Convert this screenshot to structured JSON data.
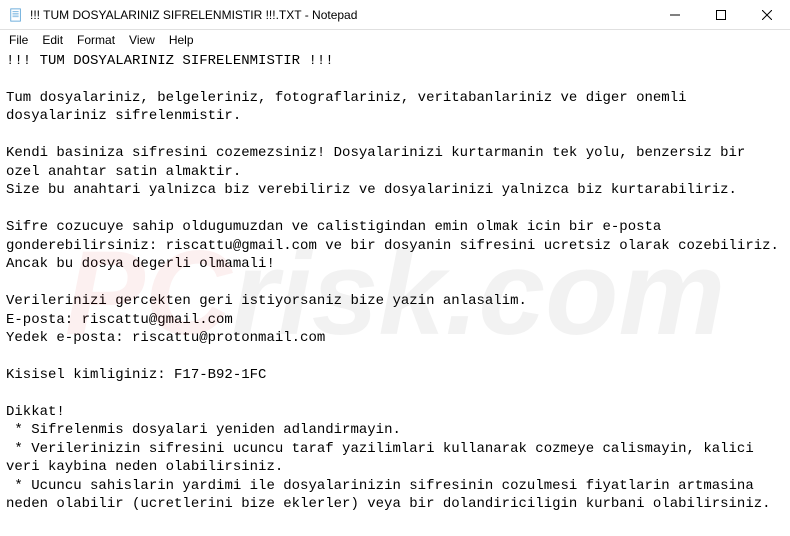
{
  "titlebar": {
    "text": "!!! TUM DOSYALARINIZ SIFRELENMISTIR !!!.TXT - Notepad"
  },
  "menubar": {
    "file": "File",
    "edit": "Edit",
    "format": "Format",
    "view": "View",
    "help": "Help"
  },
  "watermark": {
    "pc": "PC",
    "rest": "risk.com"
  },
  "content": {
    "text": "!!! TUM DOSYALARINIZ SIFRELENMISTIR !!!\n\nTum dosyalariniz, belgeleriniz, fotograflariniz, veritabanlariniz ve diger onemli dosyalariniz sifrelenmistir.\n\nKendi basiniza sifresini cozemezsiniz! Dosyalarinizi kurtarmanin tek yolu, benzersiz bir ozel anahtar satin almaktir.\nSize bu anahtari yalnizca biz verebiliriz ve dosyalarinizi yalnizca biz kurtarabiliriz.\n\nSifre cozucuye sahip oldugumuzdan ve calistigindan emin olmak icin bir e-posta gonderebilirsiniz: riscattu@gmail.com ve bir dosyanin sifresini ucretsiz olarak cozebiliriz.\nAncak bu dosya degerli olmamali!\n\nVerilerinizi gercekten geri istiyorsaniz bize yazin anlasalim.\nE-posta: riscattu@gmail.com\nYedek e-posta: riscattu@protonmail.com\n\nKisisel kimliginiz: F17-B92-1FC\n\nDikkat!\n * Sifrelenmis dosyalari yeniden adlandirmayin.\n * Verilerinizin sifresini ucuncu taraf yazilimlari kullanarak cozmeye calismayin, kalici veri kaybina neden olabilirsiniz.\n * Ucuncu sahislarin yardimi ile dosyalarinizin sifresinin cozulmesi fiyatlarin artmasina neden olabilir (ucretlerini bize eklerler) veya bir dolandiriciligin kurbani olabilirsiniz."
  }
}
